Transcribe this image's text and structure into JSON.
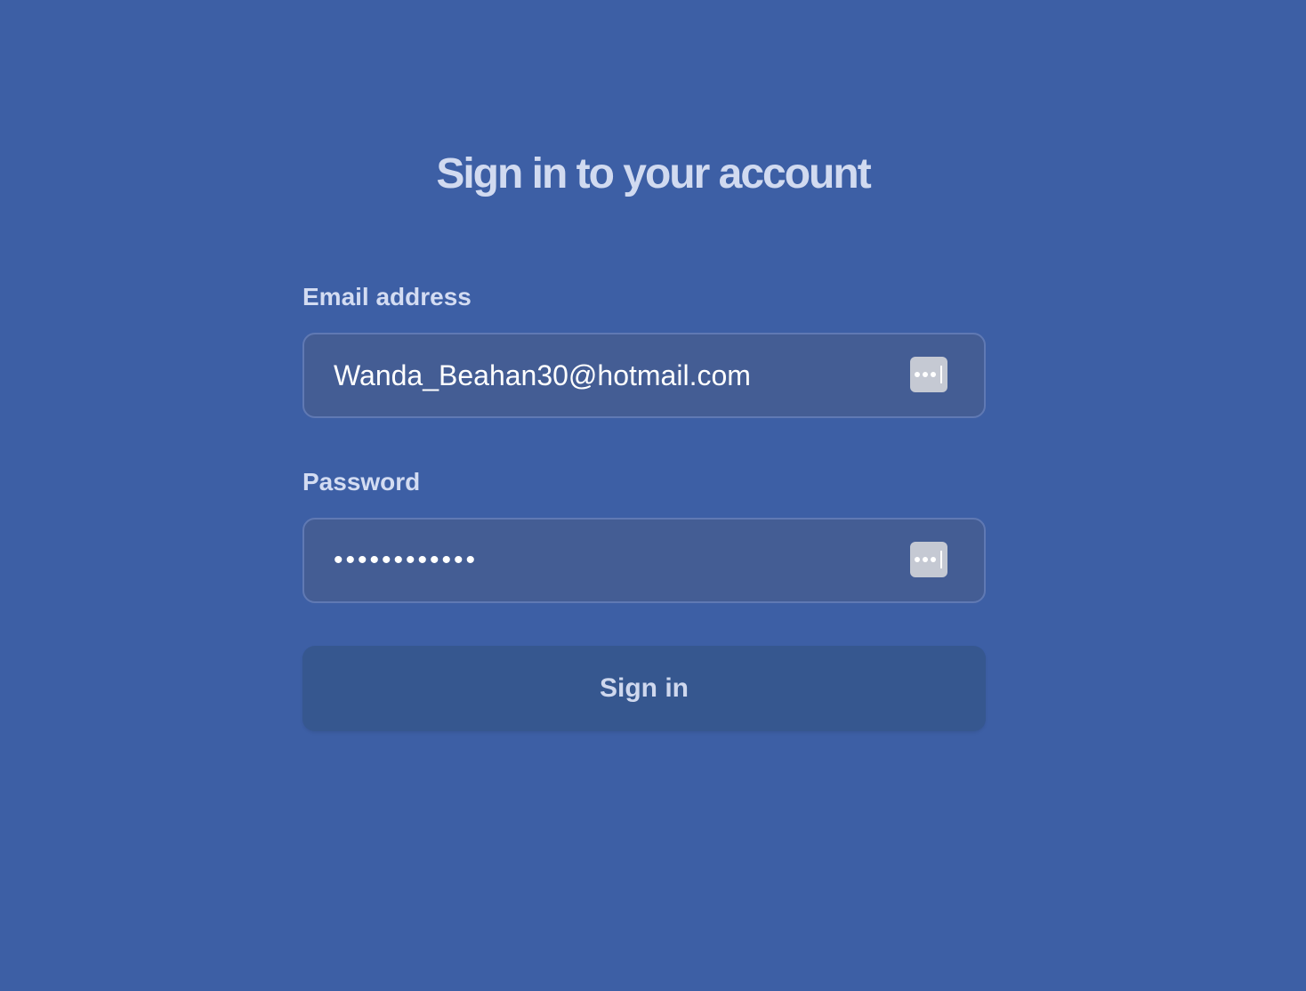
{
  "page": {
    "title": "Sign in to your account"
  },
  "form": {
    "email": {
      "label": "Email address",
      "value": "Wanda_Beahan30@hotmail.com"
    },
    "password": {
      "label": "Password",
      "masked_value": "••••••••••••"
    },
    "submit_label": "Sign in"
  },
  "icons": {
    "autofill": "password-manager-icon"
  },
  "colors": {
    "background": "#3d5fa5",
    "input_background": "#445d94",
    "button_background": "#36578f",
    "title_text": "#d1daf0"
  }
}
